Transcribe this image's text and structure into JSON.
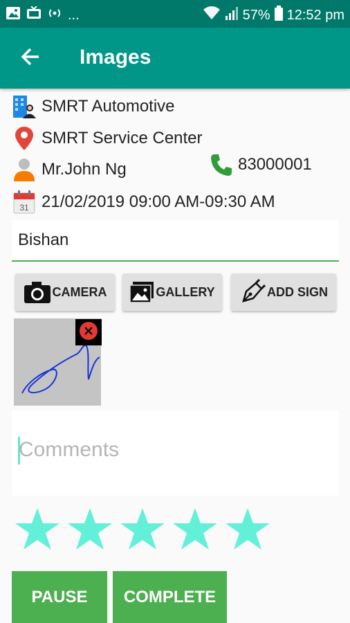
{
  "status_bar": {
    "battery": "57%",
    "time": "12:52 pm",
    "dots": "..."
  },
  "app_bar": {
    "title": "Images"
  },
  "details": {
    "company": "SMRT Automotive",
    "service_center": "SMRT Service Center",
    "contact_name": "Mr.John Ng",
    "phone": "83000001",
    "appointment": "21/02/2019 09:00 AM-09:30 AM",
    "calendar_day": "31"
  },
  "location_field": {
    "value": "Bishan"
  },
  "actions": {
    "camera_label": "CAMERA",
    "gallery_label": "GALLERY",
    "add_sign_label": "ADD SIGN"
  },
  "comments": {
    "placeholder": "Comments",
    "value": ""
  },
  "rating": {
    "stars_total": 5,
    "stars_filled": 5,
    "star_color": "#62f0d8"
  },
  "buttons": {
    "pause_label": "PAUSE",
    "complete_label": "COMPLETE"
  },
  "colors": {
    "status_bar": "#00796b",
    "app_bar": "#009688",
    "primary_button": "#4caf50",
    "phone_icon": "#2e9d3a",
    "location_pin": "#e0473a"
  }
}
